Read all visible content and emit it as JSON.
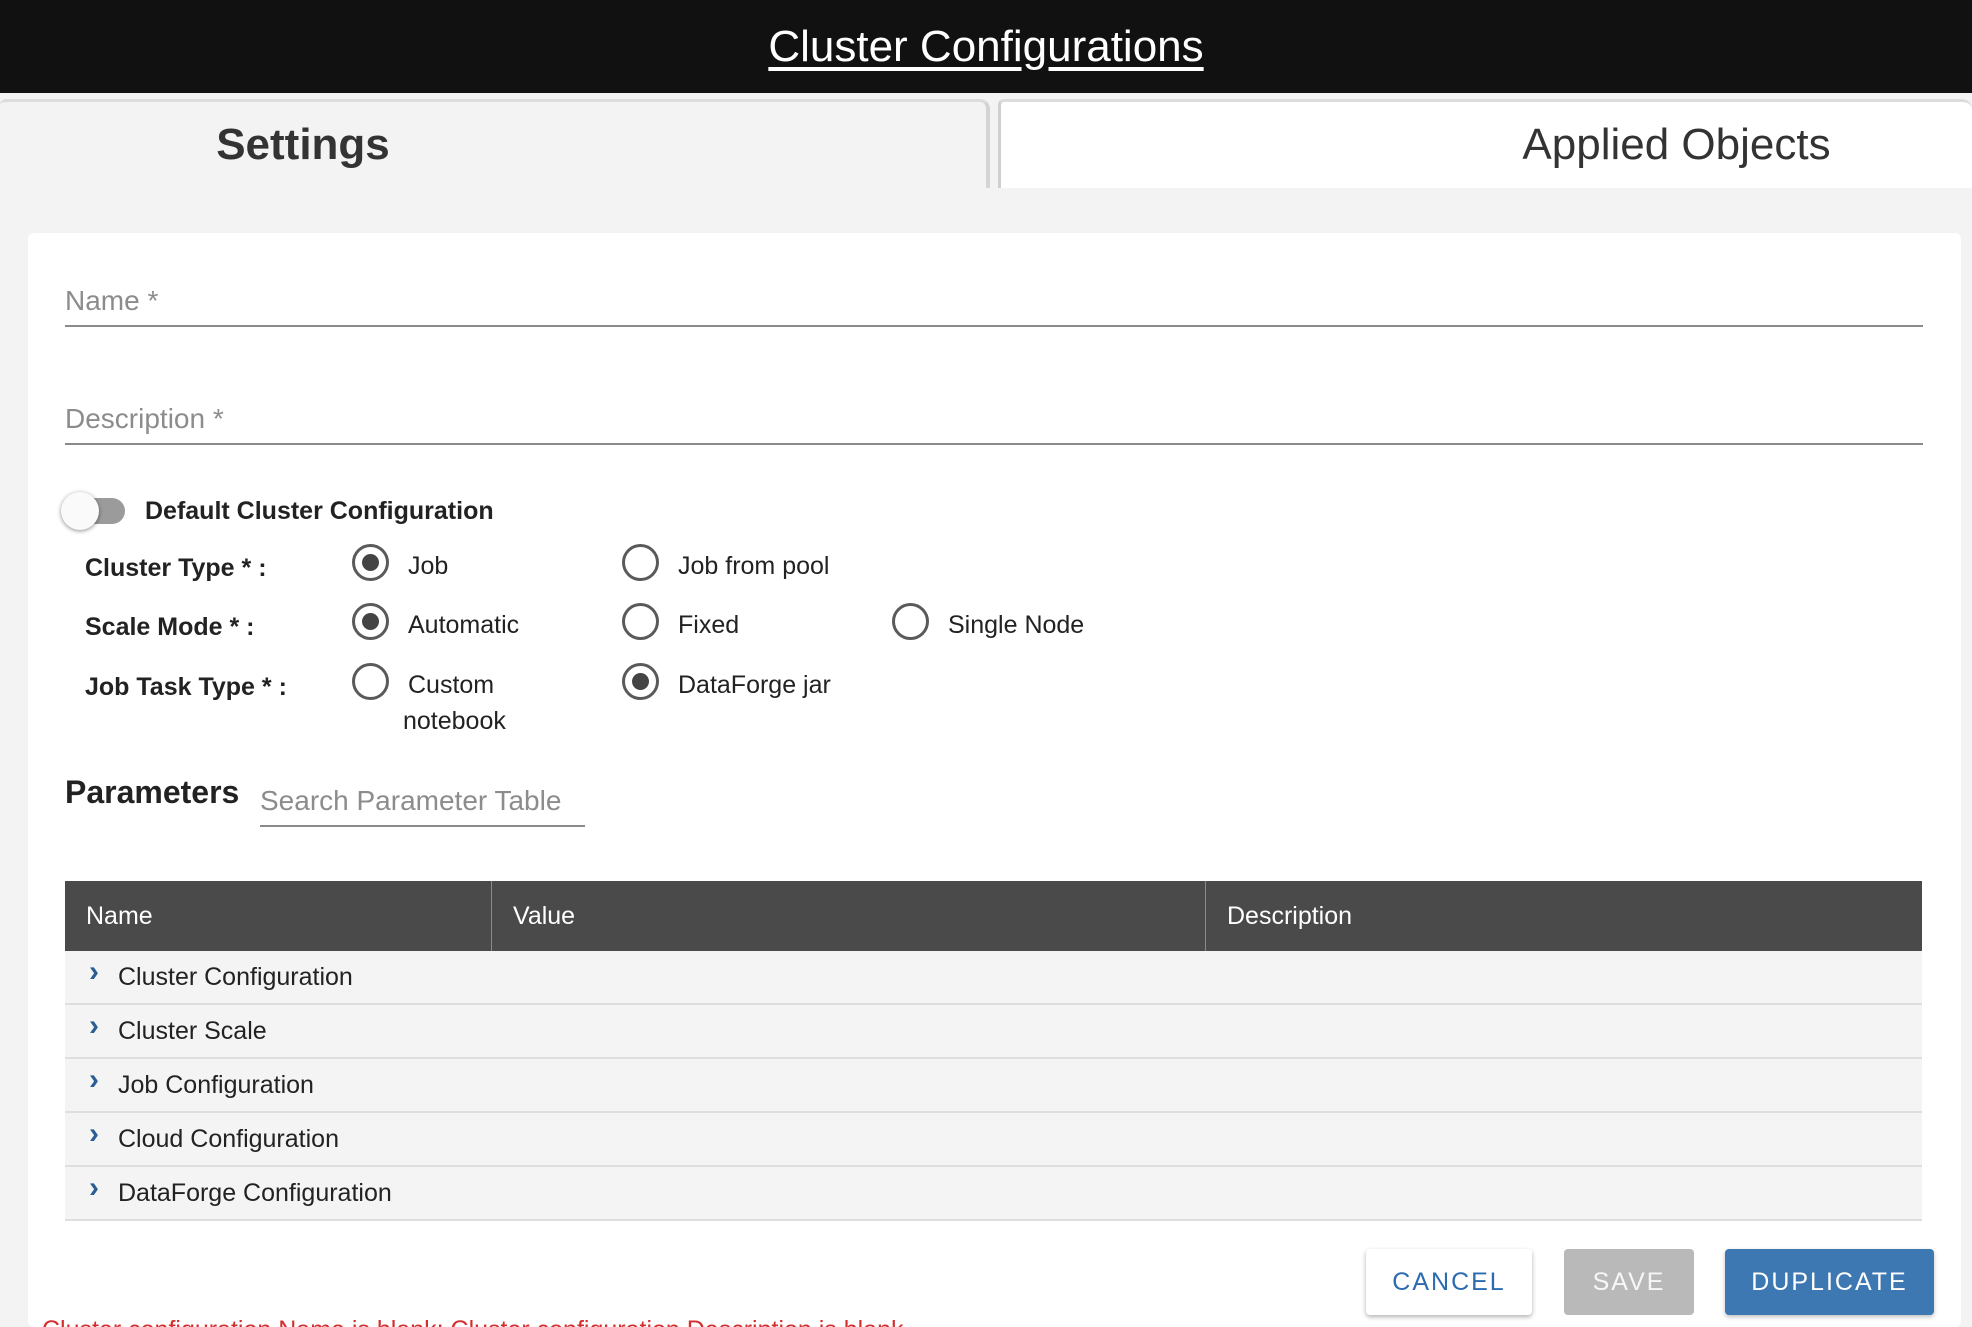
{
  "header": {
    "title": "Cluster Configurations"
  },
  "tabs": [
    {
      "label": "Settings",
      "active": true
    },
    {
      "label": "Applied Objects",
      "active": false
    }
  ],
  "form": {
    "name": {
      "placeholder": "Name *",
      "value": ""
    },
    "description": {
      "placeholder": "Description *",
      "value": ""
    },
    "default_toggle": {
      "label": "Default Cluster Configuration",
      "on": false
    },
    "cluster_type": {
      "label": "Cluster Type * :",
      "options": [
        {
          "label": "Job",
          "checked": true
        },
        {
          "label": "Job from pool",
          "checked": false
        }
      ]
    },
    "scale_mode": {
      "label": "Scale Mode * :",
      "options": [
        {
          "label": "Automatic",
          "checked": true
        },
        {
          "label": "Fixed",
          "checked": false
        },
        {
          "label": "Single Node",
          "checked": false
        }
      ]
    },
    "job_task_type": {
      "label": "Job Task Type * :",
      "options": [
        {
          "label": "Custom notebook",
          "checked": false
        },
        {
          "label": "DataForge jar",
          "checked": true
        }
      ]
    }
  },
  "parameters": {
    "title": "Parameters",
    "search_placeholder": "Search Parameter Table",
    "columns": [
      "Name",
      "Value",
      "Description"
    ],
    "rows": [
      "Cluster Configuration",
      "Cluster Scale",
      "Job Configuration",
      "Cloud Configuration",
      "DataForge Configuration"
    ]
  },
  "actions": {
    "cancel": "CANCEL",
    "save": "SAVE",
    "duplicate": "DUPLICATE"
  },
  "error": "Cluster configuration Name is blank; Cluster configuration Description is blank"
}
